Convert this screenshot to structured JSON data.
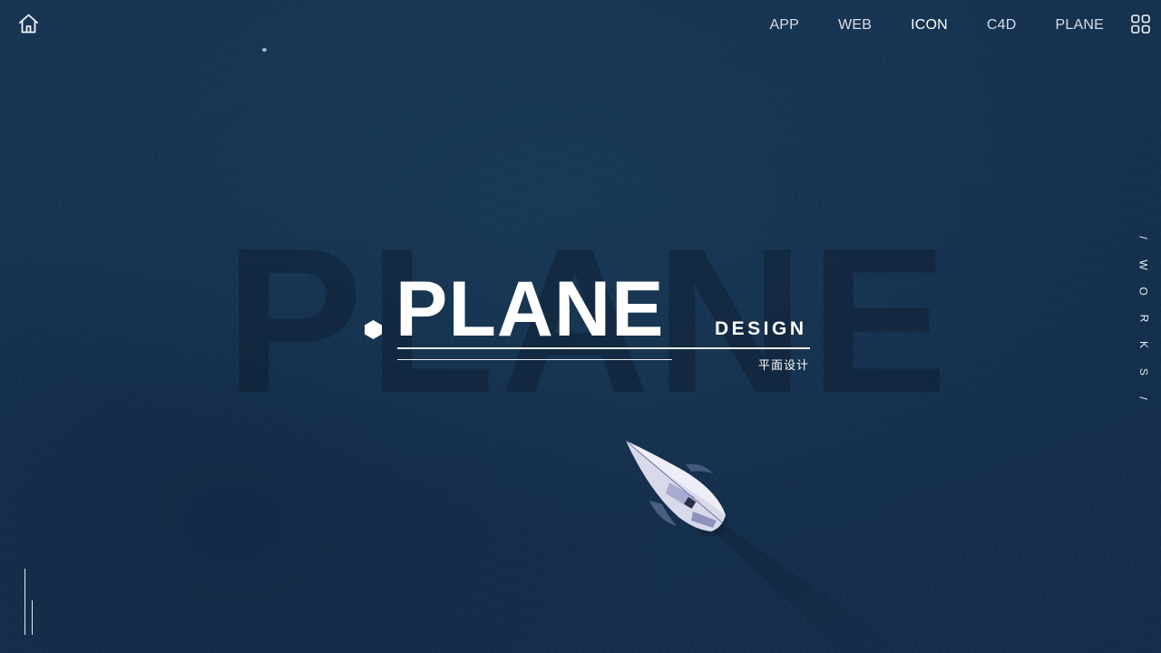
{
  "nav": {
    "items": [
      {
        "label": "APP"
      },
      {
        "label": "WEB"
      },
      {
        "label": "ICON"
      },
      {
        "label": "C4D"
      },
      {
        "label": "PLANE"
      }
    ],
    "active_label": "ICON"
  },
  "hero": {
    "background_word": "PLANE",
    "title": "PLANE",
    "design_label": "DESIGN",
    "subtitle_cn": "平面设计"
  },
  "side": {
    "vertical_letters": [
      "/",
      "W",
      "O",
      "R",
      "K",
      "S",
      "/"
    ]
  },
  "icons": {
    "home": "home-icon",
    "grid": "grid-icon",
    "bullet": "hexagon-icon"
  },
  "colors": {
    "background": "#15304c",
    "text": "#ffffff",
    "nav_text": "#d9dee6",
    "ghost_word": "#0a1828"
  }
}
